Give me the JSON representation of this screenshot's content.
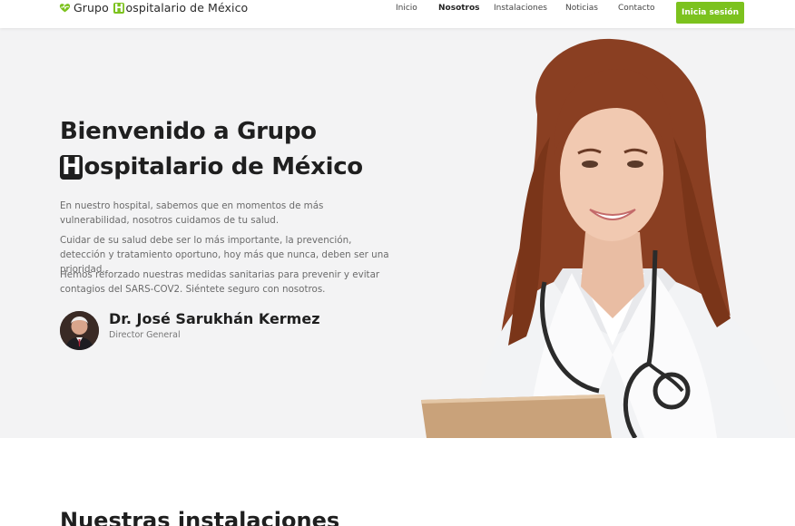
{
  "header": {
    "brand_pre": "Grupo ",
    "brand_h": "H",
    "brand_post": "ospitalario de México",
    "brand_icon": "heart-pulse-icon",
    "nav": [
      "Inicio",
      "Nosotros",
      "Instalaciones",
      "Noticias",
      "Contacto"
    ],
    "active_nav": "Nosotros",
    "login_label": "Inicia sesión"
  },
  "hero": {
    "title_line1": "Bienvenido a Grupo",
    "title_h": "H",
    "title_line2_rest": "ospitalario de México",
    "paragraphs": [
      "En nuestro hospital, sabemos que en momentos de más vulnerabilidad, nosotros cuidamos de tu salud.",
      "Cuidar de su salud debe ser lo más importante, la prevención, detección y tratamiento oportuno, hoy más que nunca, deben ser una prioridad.",
      "Hemos reforzado nuestras medidas sanitarias para prevenir y evitar contagios del SARS-COV2. Siéntete seguro con nosotros."
    ],
    "doctor_name": "Dr. José Sarukhán Kermez",
    "doctor_role": "Director General"
  },
  "section": {
    "title": "Nuestras instalaciones"
  },
  "colors": {
    "accent": "#7cc21e",
    "hero_bg": "#f3f3f4",
    "text_dark": "#1f1f1f"
  }
}
